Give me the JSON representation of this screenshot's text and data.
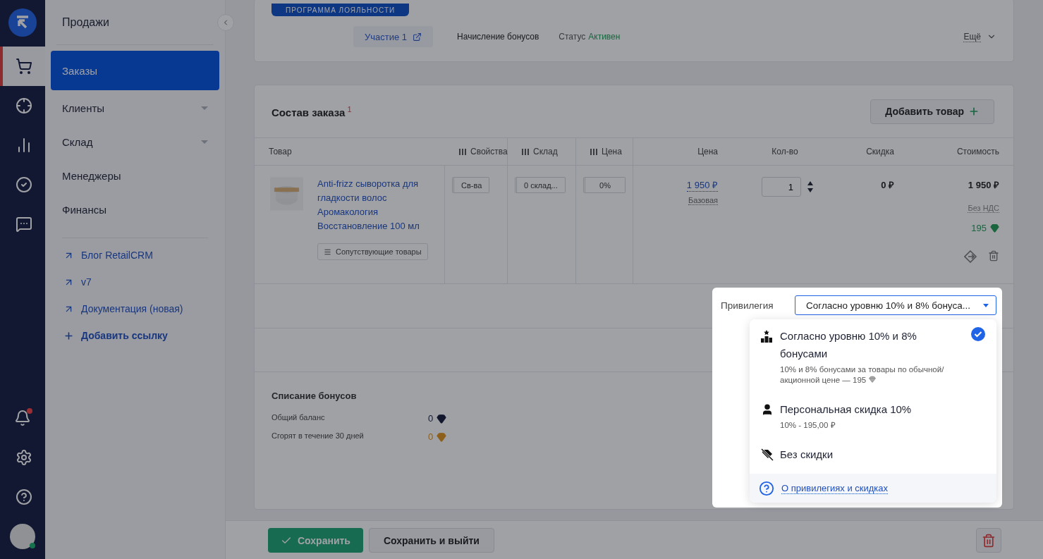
{
  "rail": {
    "items": [
      {
        "selected": true
      },
      {
        "selected": false
      },
      {
        "selected": false
      },
      {
        "selected": false
      },
      {
        "selected": false
      }
    ],
    "has_notification": true,
    "online": true
  },
  "sidebar": {
    "title": "Продажи",
    "items": [
      {
        "label": "Заказы",
        "selected": true,
        "expandable": false
      },
      {
        "label": "Клиенты",
        "selected": false,
        "expandable": true
      },
      {
        "label": "Склад",
        "selected": false,
        "expandable": true
      },
      {
        "label": "Менеджеры",
        "selected": false,
        "expandable": false
      },
      {
        "label": "Финансы",
        "selected": false,
        "expandable": false
      }
    ],
    "links": [
      {
        "label": "Блог RetailCRM",
        "kind": "external"
      },
      {
        "label": "v7",
        "kind": "external"
      },
      {
        "label": "Документация (новая)",
        "kind": "external"
      },
      {
        "label": "Добавить ссылку",
        "kind": "add"
      }
    ]
  },
  "loyalty": {
    "badge": "ПРОГРАММА ЛОЯЛЬНОСТИ",
    "participation": "Участие 1",
    "accrual": "Начисление бонусов",
    "status_label": "Статус",
    "status_value": "Активен",
    "more": "Ещё"
  },
  "order": {
    "title": "Состав заказа",
    "footnote": "1",
    "add_button": "Добавить товар",
    "columns": [
      {
        "label": "Товар",
        "kind": "plain"
      },
      {
        "label": "Свойства",
        "kind": "toggle"
      },
      {
        "label": "Склад",
        "kind": "toggle"
      },
      {
        "label": "Цена",
        "kind": "toggle"
      },
      {
        "label": "Цена",
        "kind": "plain"
      },
      {
        "label": "Кол-во",
        "kind": "plain"
      },
      {
        "label": "Скидка",
        "kind": "plain"
      },
      {
        "label": "Стоимость",
        "kind": "plain"
      }
    ],
    "rows": [
      {
        "product": "Anti-frizz сыворотка для гладкости волос Аромакология Восстановление 100 мл",
        "related": "Сопутствующие товары",
        "props": "Св-ва",
        "stock": "0 склад...",
        "discount_field": "0%",
        "price": "1 950 ₽",
        "price_type": "Базовая",
        "quantity": "1",
        "discount": "0 ₽",
        "cost": "1 950 ₽",
        "vat": "Без НДС",
        "bonus": "195"
      }
    ]
  },
  "privilege": {
    "label": "Привилегия",
    "value": "Согласно уровню 10% и 8% бонуса...",
    "options": [
      {
        "kind": "level",
        "title": "Согласно уровню 10% и 8% бонусами",
        "description": "10% и 8% бонусами за товары по обычной/акционной цене — 195",
        "selected": true
      },
      {
        "kind": "personal",
        "title": "Персональная скидка 10%",
        "description": "10% - 195,00 ₽",
        "selected": false
      },
      {
        "kind": "none",
        "title": "Без скидки",
        "selected": false
      }
    ],
    "help_link": "О привилегиях и скидках"
  },
  "bonuses": {
    "title": "Списание бонусов",
    "rows": [
      {
        "label": "Общий баланс",
        "value": "0",
        "kind": "total"
      },
      {
        "label": "Сгорят в течение 30 дней",
        "value": "0",
        "kind": "expiring"
      }
    ]
  },
  "footer": {
    "save": "Сохранить",
    "save_exit": "Сохранить и выйти"
  }
}
